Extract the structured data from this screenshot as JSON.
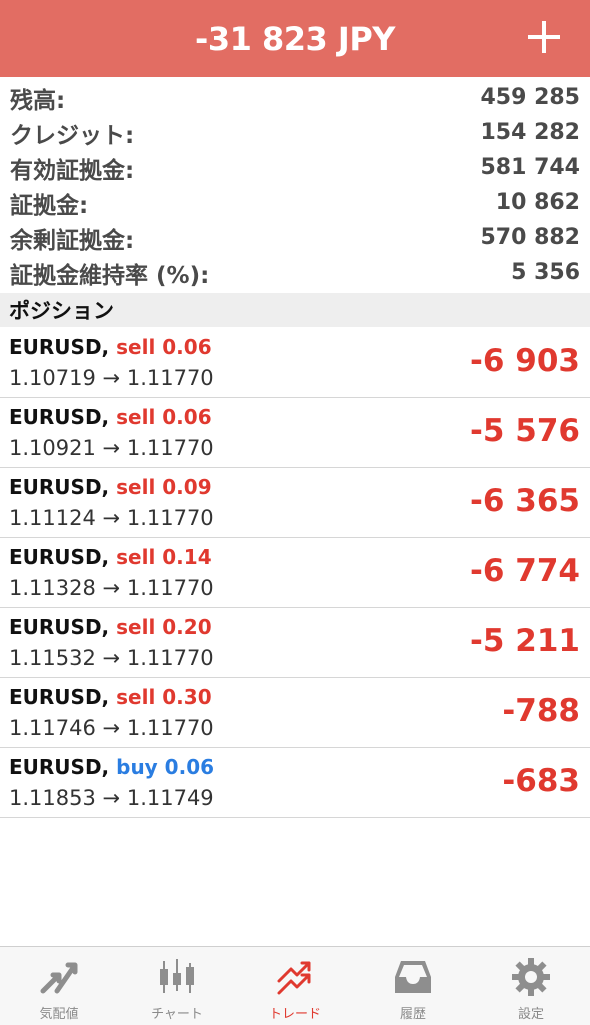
{
  "header": {
    "title": "-31 823 JPY"
  },
  "summary": [
    {
      "label": "残高:",
      "value": "459 285"
    },
    {
      "label": "クレジット:",
      "value": "154 282"
    },
    {
      "label": "有効証拠金:",
      "value": "581 744"
    },
    {
      "label": "証拠金:",
      "value": "10 862"
    },
    {
      "label": "余剰証拠金:",
      "value": "570 882"
    },
    {
      "label": "証拠金維持率 (%):",
      "value": "5 356"
    }
  ],
  "section": {
    "title": "ポジション"
  },
  "positions": [
    {
      "symbol": "EURUSD,",
      "side": "sell 0.06",
      "open": "1.10719",
      "arrow": "→",
      "current": "1.11770",
      "profit": "-6 903"
    },
    {
      "symbol": "EURUSD,",
      "side": "sell 0.06",
      "open": "1.10921",
      "arrow": "→",
      "current": "1.11770",
      "profit": "-5 576"
    },
    {
      "symbol": "EURUSD,",
      "side": "sell 0.09",
      "open": "1.11124",
      "arrow": "→",
      "current": "1.11770",
      "profit": "-6 365"
    },
    {
      "symbol": "EURUSD,",
      "side": "sell 0.14",
      "open": "1.11328",
      "arrow": "→",
      "current": "1.11770",
      "profit": "-6 774"
    },
    {
      "symbol": "EURUSD,",
      "side": "sell 0.20",
      "open": "1.11532",
      "arrow": "→",
      "current": "1.11770",
      "profit": "-5 211"
    },
    {
      "symbol": "EURUSD,",
      "side": "sell 0.30",
      "open": "1.11746",
      "arrow": "→",
      "current": "1.11770",
      "profit": "-788"
    },
    {
      "symbol": "EURUSD,",
      "side": "buy 0.06",
      "open": "1.11853",
      "arrow": "→",
      "current": "1.11749",
      "profit": "-683"
    }
  ],
  "tabs": [
    {
      "label": "気配値",
      "icon": "quotes-icon"
    },
    {
      "label": "チャート",
      "icon": "chart-icon"
    },
    {
      "label": "トレード",
      "icon": "trade-icon",
      "active": true
    },
    {
      "label": "履歴",
      "icon": "history-icon"
    },
    {
      "label": "設定",
      "icon": "settings-icon"
    }
  ],
  "colors": {
    "header": "#e26d63",
    "sell": "#e0392f",
    "buy": "#2a7de1",
    "loss": "#e0392f"
  }
}
